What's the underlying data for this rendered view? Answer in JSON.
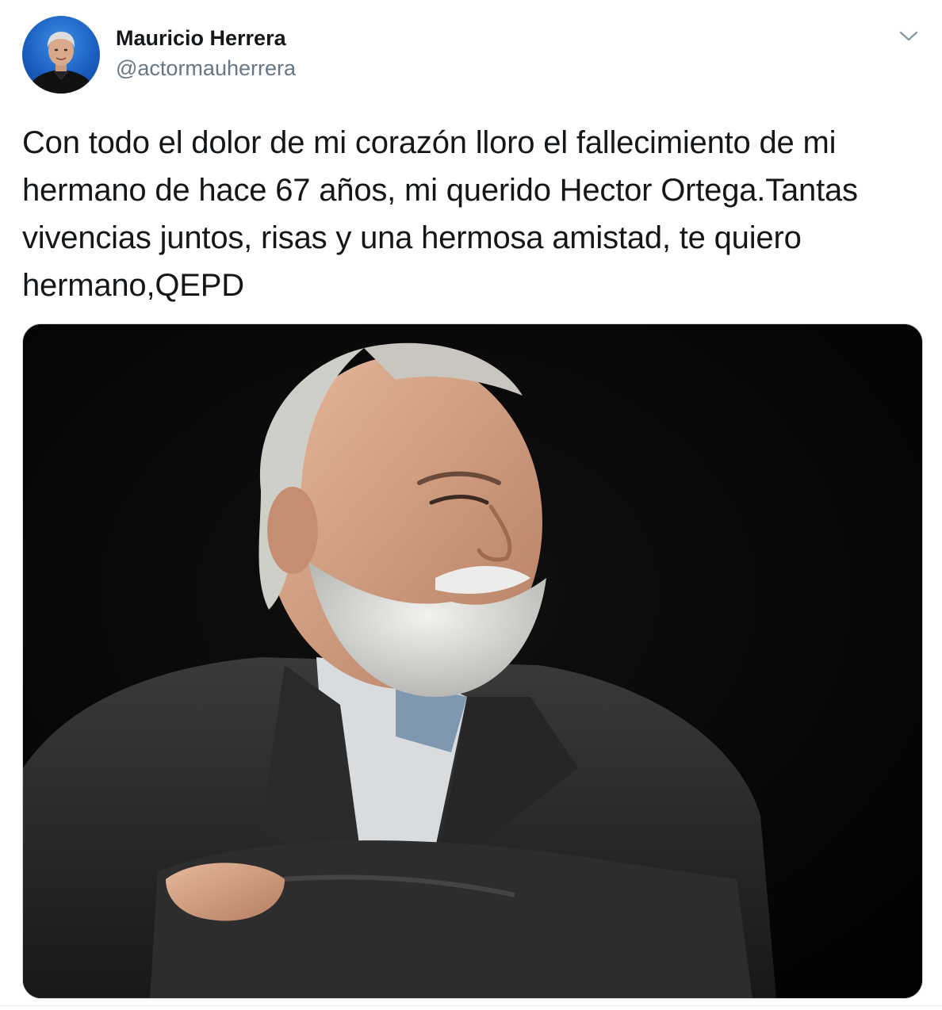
{
  "tweet": {
    "author": {
      "display_name": "Mauricio Herrera",
      "handle": "@actormauherrera"
    },
    "text": "Con todo el dolor de mi corazón lloro el fallecimiento de mi hermano de hace 67 años, mi querido Hector Ortega.Tantas vivencias juntos, risas y una hermosa amistad, te quiero hermano,QEPD",
    "more_icon": "chevron-down-icon",
    "colors": {
      "text": "#14171a",
      "secondary": "#657786",
      "border": "#ccd6dd"
    }
  }
}
